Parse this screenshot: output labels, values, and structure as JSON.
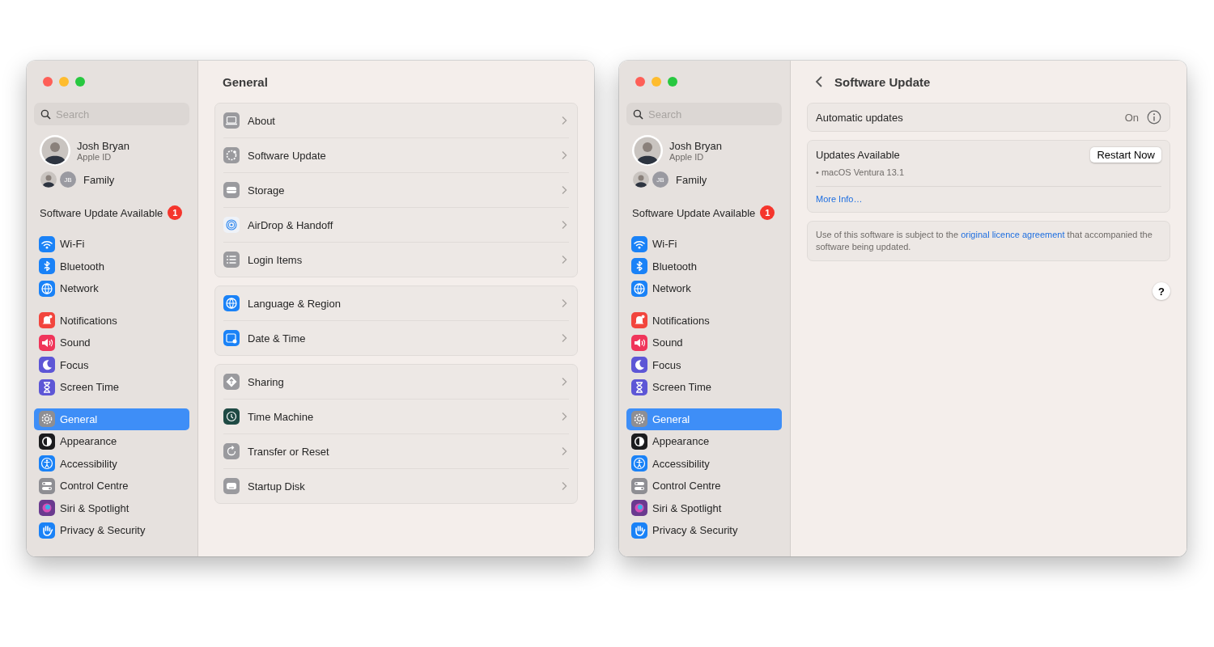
{
  "windows": [
    {
      "sidebar": {
        "search": {
          "placeholder": "Search"
        },
        "profile": {
          "name": "Josh Bryan",
          "subtitle": "Apple ID"
        },
        "family": {
          "initials": "JB",
          "label": "Family"
        },
        "update_notice": {
          "label": "Software Update Available",
          "badge": "1"
        },
        "groups": [
          {
            "items": [
              {
                "label": "Wi-Fi",
                "color": "#1a82f7",
                "selected": false
              },
              {
                "label": "Bluetooth",
                "color": "#1a82f7",
                "selected": false
              },
              {
                "label": "Network",
                "color": "#1a82f7",
                "selected": false
              }
            ]
          },
          {
            "items": [
              {
                "label": "Notifications",
                "color": "#f2453d",
                "selected": false
              },
              {
                "label": "Sound",
                "color": "#f0355a",
                "selected": false
              },
              {
                "label": "Focus",
                "color": "#5d56d6",
                "selected": false
              },
              {
                "label": "Screen Time",
                "color": "#5d56d6",
                "selected": false
              }
            ]
          },
          {
            "items": [
              {
                "label": "General",
                "color": "#8e8e93",
                "selected": true
              },
              {
                "label": "Appearance",
                "color": "#1c1c1e",
                "selected": false
              },
              {
                "label": "Accessibility",
                "color": "#1a82f7",
                "selected": false
              },
              {
                "label": "Control Centre",
                "color": "#8e8e93",
                "selected": false
              },
              {
                "label": "Siri & Spotlight",
                "color": "#6a3a8f",
                "selected": false
              },
              {
                "label": "Privacy & Security",
                "color": "#1a82f7",
                "selected": false
              }
            ]
          }
        ]
      },
      "content": {
        "kind": "general",
        "title": "General",
        "groups": [
          {
            "rows": [
              {
                "label": "About",
                "color": "#9a9a9e"
              },
              {
                "label": "Software Update",
                "color": "#9a9a9e"
              },
              {
                "label": "Storage",
                "color": "#9a9a9e"
              },
              {
                "label": "AirDrop & Handoff",
                "color": "#eef2f8"
              },
              {
                "label": "Login Items",
                "color": "#9a9a9e"
              }
            ]
          },
          {
            "rows": [
              {
                "label": "Language & Region",
                "color": "#1a82f7"
              },
              {
                "label": "Date & Time",
                "color": "#1a82f7"
              }
            ]
          },
          {
            "rows": [
              {
                "label": "Sharing",
                "color": "#9a9a9e"
              },
              {
                "label": "Time Machine",
                "color": "#1f4a44"
              },
              {
                "label": "Transfer or Reset",
                "color": "#9a9a9e"
              },
              {
                "label": "Startup Disk",
                "color": "#9a9a9e"
              }
            ]
          }
        ]
      }
    },
    {
      "sidebar": {
        "search": {
          "placeholder": "Search"
        },
        "profile": {
          "name": "Josh Bryan",
          "subtitle": "Apple ID"
        },
        "family": {
          "initials": "JB",
          "label": "Family"
        },
        "update_notice": {
          "label": "Software Update Available",
          "badge": "1"
        },
        "groups": [
          {
            "items": [
              {
                "label": "Wi-Fi",
                "color": "#1a82f7",
                "selected": false
              },
              {
                "label": "Bluetooth",
                "color": "#1a82f7",
                "selected": false
              },
              {
                "label": "Network",
                "color": "#1a82f7",
                "selected": false
              }
            ]
          },
          {
            "items": [
              {
                "label": "Notifications",
                "color": "#f2453d",
                "selected": false
              },
              {
                "label": "Sound",
                "color": "#f0355a",
                "selected": false
              },
              {
                "label": "Focus",
                "color": "#5d56d6",
                "selected": false
              },
              {
                "label": "Screen Time",
                "color": "#5d56d6",
                "selected": false
              }
            ]
          },
          {
            "items": [
              {
                "label": "General",
                "color": "#8e8e93",
                "selected": true
              },
              {
                "label": "Appearance",
                "color": "#1c1c1e",
                "selected": false
              },
              {
                "label": "Accessibility",
                "color": "#1a82f7",
                "selected": false
              },
              {
                "label": "Control Centre",
                "color": "#8e8e93",
                "selected": false
              },
              {
                "label": "Siri & Spotlight",
                "color": "#6a3a8f",
                "selected": false
              },
              {
                "label": "Privacy & Security",
                "color": "#1a82f7",
                "selected": false
              }
            ]
          }
        ]
      },
      "content": {
        "kind": "software_update",
        "title": "Software Update",
        "automatic": {
          "label": "Automatic updates",
          "value": "On"
        },
        "updates": {
          "title": "Updates Available",
          "button": "Restart Now",
          "item": "• macOS Ventura 13.1",
          "link": "More Info…"
        },
        "licence": {
          "before": "Use of this software is subject to the ",
          "link": "original licence agreement",
          "after": " that accompanied the software being updated."
        },
        "help": "?"
      }
    }
  ]
}
